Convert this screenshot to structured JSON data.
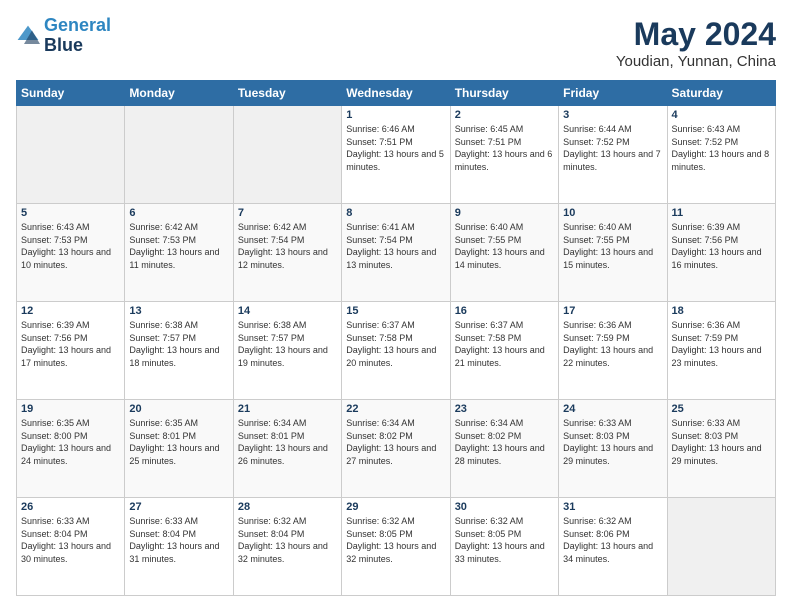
{
  "logo": {
    "line1": "General",
    "line2": "Blue"
  },
  "title": "May 2024",
  "subtitle": "Youdian, Yunnan, China",
  "weekdays": [
    "Sunday",
    "Monday",
    "Tuesday",
    "Wednesday",
    "Thursday",
    "Friday",
    "Saturday"
  ],
  "weeks": [
    [
      {
        "day": "",
        "info": ""
      },
      {
        "day": "",
        "info": ""
      },
      {
        "day": "",
        "info": ""
      },
      {
        "day": "1",
        "info": "Sunrise: 6:46 AM\nSunset: 7:51 PM\nDaylight: 13 hours and 5 minutes."
      },
      {
        "day": "2",
        "info": "Sunrise: 6:45 AM\nSunset: 7:51 PM\nDaylight: 13 hours and 6 minutes."
      },
      {
        "day": "3",
        "info": "Sunrise: 6:44 AM\nSunset: 7:52 PM\nDaylight: 13 hours and 7 minutes."
      },
      {
        "day": "4",
        "info": "Sunrise: 6:43 AM\nSunset: 7:52 PM\nDaylight: 13 hours and 8 minutes."
      }
    ],
    [
      {
        "day": "5",
        "info": "Sunrise: 6:43 AM\nSunset: 7:53 PM\nDaylight: 13 hours and 10 minutes."
      },
      {
        "day": "6",
        "info": "Sunrise: 6:42 AM\nSunset: 7:53 PM\nDaylight: 13 hours and 11 minutes."
      },
      {
        "day": "7",
        "info": "Sunrise: 6:42 AM\nSunset: 7:54 PM\nDaylight: 13 hours and 12 minutes."
      },
      {
        "day": "8",
        "info": "Sunrise: 6:41 AM\nSunset: 7:54 PM\nDaylight: 13 hours and 13 minutes."
      },
      {
        "day": "9",
        "info": "Sunrise: 6:40 AM\nSunset: 7:55 PM\nDaylight: 13 hours and 14 minutes."
      },
      {
        "day": "10",
        "info": "Sunrise: 6:40 AM\nSunset: 7:55 PM\nDaylight: 13 hours and 15 minutes."
      },
      {
        "day": "11",
        "info": "Sunrise: 6:39 AM\nSunset: 7:56 PM\nDaylight: 13 hours and 16 minutes."
      }
    ],
    [
      {
        "day": "12",
        "info": "Sunrise: 6:39 AM\nSunset: 7:56 PM\nDaylight: 13 hours and 17 minutes."
      },
      {
        "day": "13",
        "info": "Sunrise: 6:38 AM\nSunset: 7:57 PM\nDaylight: 13 hours and 18 minutes."
      },
      {
        "day": "14",
        "info": "Sunrise: 6:38 AM\nSunset: 7:57 PM\nDaylight: 13 hours and 19 minutes."
      },
      {
        "day": "15",
        "info": "Sunrise: 6:37 AM\nSunset: 7:58 PM\nDaylight: 13 hours and 20 minutes."
      },
      {
        "day": "16",
        "info": "Sunrise: 6:37 AM\nSunset: 7:58 PM\nDaylight: 13 hours and 21 minutes."
      },
      {
        "day": "17",
        "info": "Sunrise: 6:36 AM\nSunset: 7:59 PM\nDaylight: 13 hours and 22 minutes."
      },
      {
        "day": "18",
        "info": "Sunrise: 6:36 AM\nSunset: 7:59 PM\nDaylight: 13 hours and 23 minutes."
      }
    ],
    [
      {
        "day": "19",
        "info": "Sunrise: 6:35 AM\nSunset: 8:00 PM\nDaylight: 13 hours and 24 minutes."
      },
      {
        "day": "20",
        "info": "Sunrise: 6:35 AM\nSunset: 8:01 PM\nDaylight: 13 hours and 25 minutes."
      },
      {
        "day": "21",
        "info": "Sunrise: 6:34 AM\nSunset: 8:01 PM\nDaylight: 13 hours and 26 minutes."
      },
      {
        "day": "22",
        "info": "Sunrise: 6:34 AM\nSunset: 8:02 PM\nDaylight: 13 hours and 27 minutes."
      },
      {
        "day": "23",
        "info": "Sunrise: 6:34 AM\nSunset: 8:02 PM\nDaylight: 13 hours and 28 minutes."
      },
      {
        "day": "24",
        "info": "Sunrise: 6:33 AM\nSunset: 8:03 PM\nDaylight: 13 hours and 29 minutes."
      },
      {
        "day": "25",
        "info": "Sunrise: 6:33 AM\nSunset: 8:03 PM\nDaylight: 13 hours and 29 minutes."
      }
    ],
    [
      {
        "day": "26",
        "info": "Sunrise: 6:33 AM\nSunset: 8:04 PM\nDaylight: 13 hours and 30 minutes."
      },
      {
        "day": "27",
        "info": "Sunrise: 6:33 AM\nSunset: 8:04 PM\nDaylight: 13 hours and 31 minutes."
      },
      {
        "day": "28",
        "info": "Sunrise: 6:32 AM\nSunset: 8:04 PM\nDaylight: 13 hours and 32 minutes."
      },
      {
        "day": "29",
        "info": "Sunrise: 6:32 AM\nSunset: 8:05 PM\nDaylight: 13 hours and 32 minutes."
      },
      {
        "day": "30",
        "info": "Sunrise: 6:32 AM\nSunset: 8:05 PM\nDaylight: 13 hours and 33 minutes."
      },
      {
        "day": "31",
        "info": "Sunrise: 6:32 AM\nSunset: 8:06 PM\nDaylight: 13 hours and 34 minutes."
      },
      {
        "day": "",
        "info": ""
      }
    ]
  ]
}
